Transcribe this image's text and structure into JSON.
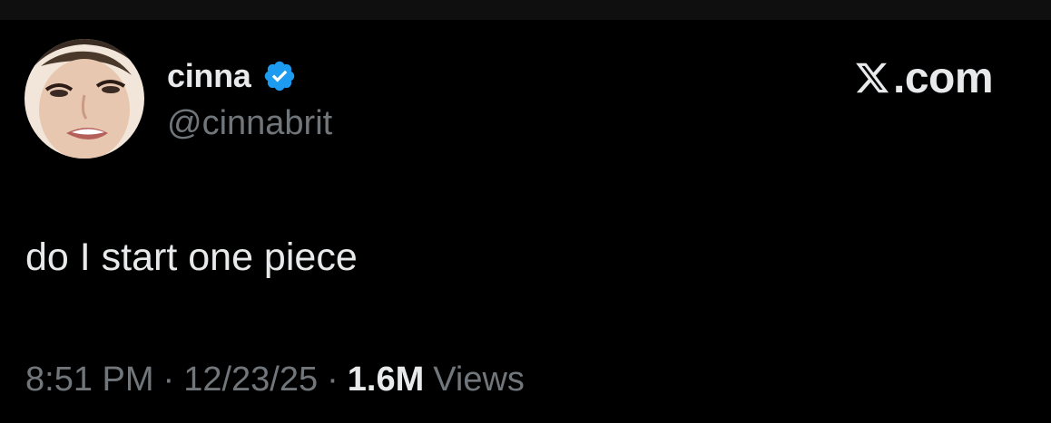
{
  "author": {
    "display_name": "cinna",
    "handle": "@cinnabrit",
    "verified": true,
    "verified_color": "#1d9bf0"
  },
  "watermark": {
    "text": ".com",
    "icon": "x-logo-icon"
  },
  "tweet": {
    "text": "do I start one piece"
  },
  "meta": {
    "time": "8:51 PM",
    "separator": "·",
    "date": "12/23/25",
    "views_count": "1.6M",
    "views_label": "Views"
  },
  "colors": {
    "background": "#000000",
    "primary_text": "#e7e9ea",
    "secondary_text": "#71767b",
    "accent": "#1d9bf0"
  }
}
